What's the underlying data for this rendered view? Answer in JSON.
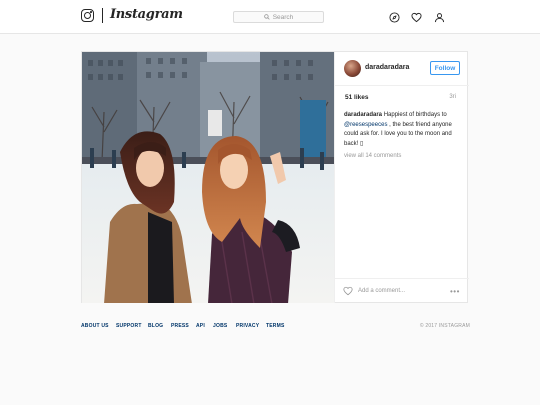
{
  "brand": {
    "wordmark": "Instagram"
  },
  "search": {
    "label": "Search"
  },
  "nav_icons": [
    "compass-icon",
    "heart-icon",
    "profile-icon"
  ],
  "post": {
    "username": "daradaradara",
    "follow_label": "Follow",
    "likes": "51 likes",
    "age": "3ri",
    "caption": {
      "user": "daradaradara",
      "text_before": " Happiest of birthdays to ",
      "mention": "@reesespeeces",
      "text_after": " , the best friend anyone could ask for. I love you to the moon and back! ",
      "emoji_glyph": "▯"
    },
    "view_comments": "view all 14 comments",
    "add_comment": "Add a comment...",
    "more": "•••"
  },
  "footer": {
    "links": [
      "ABOUT US",
      "SUPPORT",
      "BLOG",
      "PRESS",
      "API",
      "JOBS",
      "PRIVACY",
      "TERMS"
    ],
    "copyright": "© 2017 INSTAGRAM"
  },
  "colors": {
    "accent": "#3897f0",
    "link": "#003569",
    "muted": "#999999",
    "border": "#e6e6e6"
  }
}
